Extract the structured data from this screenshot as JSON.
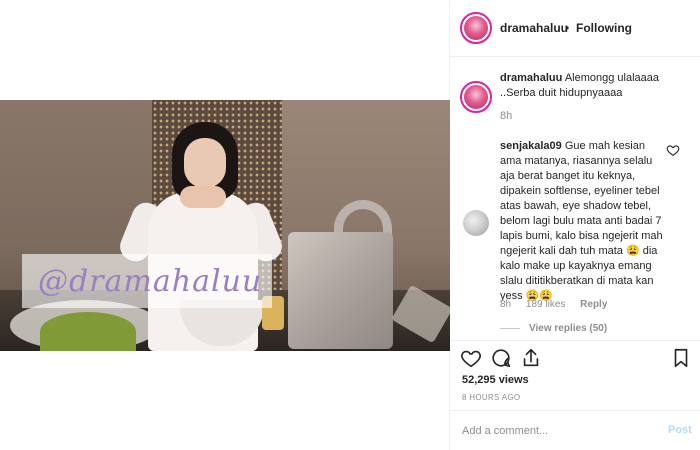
{
  "header": {
    "username": "dramahaluu",
    "separator": "•",
    "follow_status": "Following"
  },
  "caption": {
    "username": "dramahaluu",
    "text": "Alemongg ulalaaaa ..Serba duit hidupnyaaaa",
    "time": "8h"
  },
  "comment": {
    "username": "senjakala09",
    "text": "Gue mah kesian ama matanya, riasannya selalu aja berat banget itu keknya, dipakein softlense, eyeliner tebel atas bawah, eye shadow tebel, belom lagi bulu mata anti badai 7 lapis bumi, kalo bisa ngejerit mah ngejerit kali dah tuh mata 😩 dia kalo make up kayaknya emang slalu dititikberatkan di mata kan yess 😩😩",
    "time": "8h",
    "likes": "189 likes",
    "reply_label": "Reply",
    "view_replies": "View replies (50)"
  },
  "video": {
    "watermark": "@dramahaluu"
  },
  "actions": {
    "views": "52,295 views",
    "timestamp": "8 HOURS AGO",
    "icons": [
      "heart-icon",
      "comment-icon",
      "share-icon",
      "bookmark-icon"
    ]
  },
  "add_comment": {
    "placeholder": "Add a comment...",
    "post_label": "Post"
  },
  "colors": {
    "accent_ring": "#d6249f",
    "post_disabled": "#b3dbff",
    "muted_text": "#8e8e8e"
  }
}
